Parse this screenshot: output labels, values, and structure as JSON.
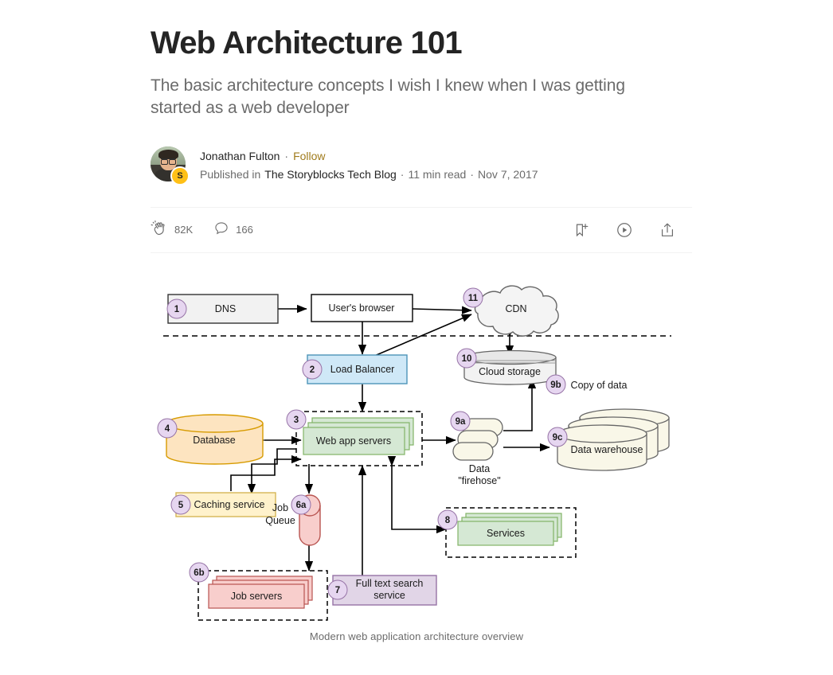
{
  "article": {
    "title": "Web Architecture 101",
    "subtitle": "The basic architecture concepts I wish I knew when I was getting started as a web developer",
    "author": "Jonathan Fulton",
    "follow_label": "Follow",
    "published_in_label": "Published in",
    "publication": "The Storyblocks Tech Blog",
    "read_time": "11 min read",
    "date": "Nov 7, 2017",
    "publication_badge": "S",
    "separator": "·"
  },
  "engagement": {
    "claps": "82K",
    "comments": "166",
    "clap_icon": "clap-icon",
    "comment_icon": "comment-icon",
    "bookmark_icon": "bookmark-add-icon",
    "listen_icon": "play-circle-icon",
    "share_icon": "share-icon"
  },
  "figure": {
    "caption": "Modern web application architecture overview"
  },
  "chart_data": {
    "type": "diagram",
    "title": "Modern web application architecture overview",
    "nodes": [
      {
        "id": "1",
        "label": "DNS",
        "shape": "rect",
        "fill": "#f5f5f5",
        "stroke": "#333333"
      },
      {
        "id": "",
        "label": "User's browser",
        "shape": "rect",
        "fill": "#ffffff",
        "stroke": "#000000"
      },
      {
        "id": "11",
        "label": "CDN",
        "shape": "cloud",
        "fill": "#f5f5f5",
        "stroke": "#666666"
      },
      {
        "id": "2",
        "label": "Load Balancer",
        "shape": "rect",
        "fill": "#cfe8f7",
        "stroke": "#4d94b8"
      },
      {
        "id": "10",
        "label": "Cloud storage",
        "shape": "disk-stack",
        "fill": "#f2f2f2",
        "stroke": "#666666"
      },
      {
        "id": "3",
        "label": "Web app servers",
        "shape": "stacked-rect",
        "fill": "#d5e8d4",
        "stroke": "#82b366"
      },
      {
        "id": "4",
        "label": "Database",
        "shape": "cylinder",
        "fill": "#fde4c0",
        "stroke": "#d79b00"
      },
      {
        "id": "5",
        "label": "Caching service",
        "shape": "rect",
        "fill": "#fff2cc",
        "stroke": "#d6b656"
      },
      {
        "id": "6a",
        "label": "Job Queue",
        "shape": "v-cylinder",
        "fill": "#f8cecc",
        "stroke": "#b85450"
      },
      {
        "id": "6b",
        "label": "Job servers",
        "shape": "stacked-rect",
        "fill": "#f8cecc",
        "stroke": "#b85450"
      },
      {
        "id": "7",
        "label": "Full text search service",
        "shape": "rect",
        "fill": "#e1d5e7",
        "stroke": "#9673a6"
      },
      {
        "id": "8",
        "label": "Services",
        "shape": "stacked-rect",
        "fill": "#d5e8d4",
        "stroke": "#82b366"
      },
      {
        "id": "9a",
        "label": "Data \"firehose\"",
        "shape": "pill-stack",
        "fill": "#f9f7e8",
        "stroke": "#666666"
      },
      {
        "id": "9b",
        "label": "Copy of data",
        "shape": "label",
        "fill": "none",
        "stroke": "none"
      },
      {
        "id": "9c",
        "label": "Data warehouse",
        "shape": "cylinder-stack",
        "fill": "#f9f7e8",
        "stroke": "#666666"
      }
    ],
    "labels": {
      "dns": "DNS",
      "browser": "User's browser",
      "cdn": "CDN",
      "load_balancer": "Load Balancer",
      "cloud_storage": "Cloud storage",
      "web_app_servers": "Web app servers",
      "database": "Database",
      "caching_service": "Caching service",
      "job_queue_line1": "Job",
      "job_queue_line2": "Queue",
      "job_servers": "Job servers",
      "full_text_line1": "Full text search",
      "full_text_line2": "service",
      "services": "Services",
      "data_line1": "Data",
      "data_line2": "\"firehose\"",
      "copy_of_data": "Copy of data",
      "data_warehouse": "Data warehouse"
    },
    "badges": [
      "1",
      "2",
      "3",
      "4",
      "5",
      "6a",
      "6b",
      "7",
      "8",
      "9a",
      "9b",
      "9c",
      "10",
      "11"
    ],
    "edges": [
      {
        "from": "DNS",
        "to": "User's browser",
        "dir": "both"
      },
      {
        "from": "User's browser",
        "to": "CDN",
        "dir": "both"
      },
      {
        "from": "User's browser",
        "to": "Load Balancer",
        "dir": "both"
      },
      {
        "from": "Load Balancer",
        "to": "CDN",
        "dir": "both"
      },
      {
        "from": "CDN",
        "to": "Cloud storage",
        "dir": "both"
      },
      {
        "from": "Load Balancer",
        "to": "Web app servers",
        "dir": "both"
      },
      {
        "from": "Database",
        "to": "Web app servers",
        "dir": "both"
      },
      {
        "from": "Web app servers",
        "to": "Caching service",
        "dir": "both"
      },
      {
        "from": "Web app servers",
        "to": "Job Queue",
        "dir": "both"
      },
      {
        "from": "Job Queue",
        "to": "Job servers",
        "dir": "both"
      },
      {
        "from": "Web app servers",
        "to": "Full text search service",
        "dir": "both"
      },
      {
        "from": "Web app servers",
        "to": "Services",
        "dir": "both"
      },
      {
        "from": "Web app servers",
        "to": "Data firehose",
        "dir": "to"
      },
      {
        "from": "Data firehose",
        "to": "Cloud storage",
        "dir": "to"
      },
      {
        "from": "Data firehose",
        "to": "Data warehouse",
        "dir": "to"
      }
    ]
  }
}
